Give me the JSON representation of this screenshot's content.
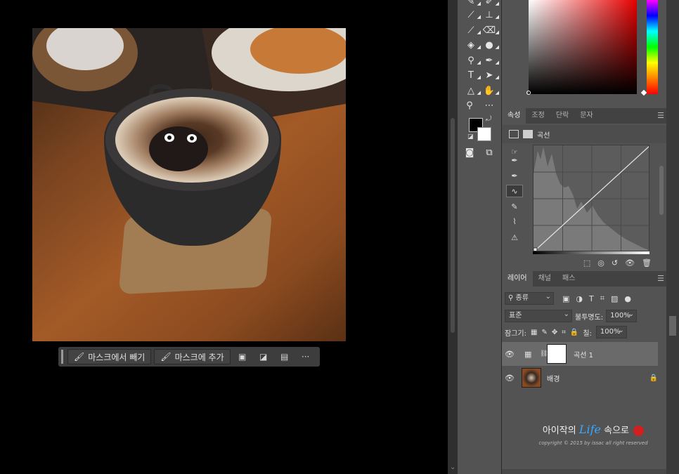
{
  "mask_bar": {
    "subtract_label": "마스크에서 빼기",
    "add_label": "마스크에 추가",
    "more_label": "···"
  },
  "properties": {
    "tabs": [
      "속성",
      "조정",
      "단락",
      "문자"
    ],
    "adjustment_name": "곡선"
  },
  "layers_panel": {
    "tabs": [
      "레이어",
      "채널",
      "패스"
    ],
    "filter_label": "종류",
    "blend_mode": "표준",
    "opacity_label": "불투명도:",
    "opacity_value": "100%",
    "lock_label": "잠그기:",
    "fill_label": "칠:",
    "fill_value": "100%",
    "layers": [
      {
        "name": "곡선 1",
        "selected": true
      },
      {
        "name": "배경",
        "selected": false
      }
    ]
  },
  "watermark": {
    "prefix": "아이작의",
    "life": "Life",
    "suffix": "속으로",
    "copyright": "copyright © 2015 by issac all right reserved"
  },
  "colors": {
    "foreground": "#000000",
    "background": "#ffffff",
    "picker_hue": "#e60000"
  }
}
